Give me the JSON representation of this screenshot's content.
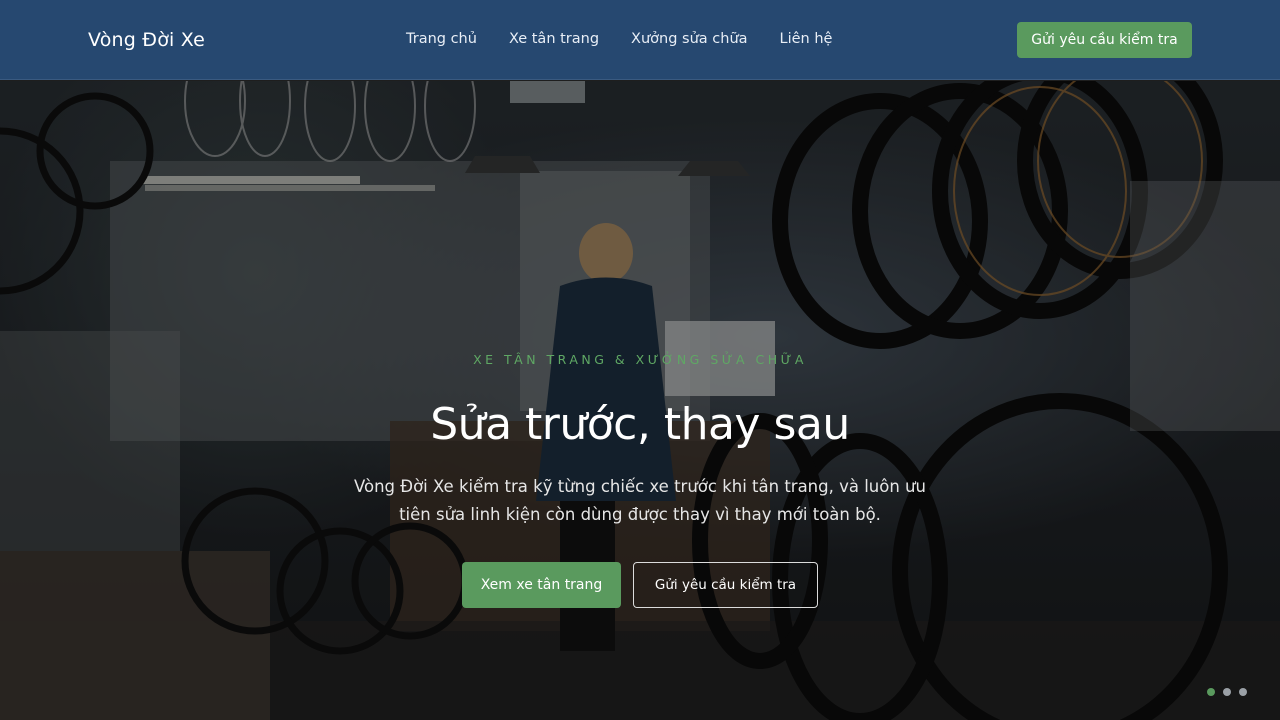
{
  "header": {
    "brand": "Vòng Đời Xe",
    "nav": [
      "Trang chủ",
      "Xe tân trang",
      "Xưởng sửa chữa",
      "Liên hệ"
    ],
    "cta": "Gửi yêu cầu kiểm tra"
  },
  "hero": {
    "eyebrow": "XE TÂN TRANG & XƯỞNG SỬA CHỮA",
    "title": "Sửa trước, thay sau",
    "description": "Vòng Đời Xe kiểm tra kỹ từng chiếc xe trước khi tân trang, và luôn ưu tiên sửa linh kiện còn dùng được thay vì thay mới toàn bộ.",
    "primary_button": "Xem xe tân trang",
    "secondary_button": "Gửi yêu cầu kiểm tra",
    "slides": 3,
    "active_slide": 1
  },
  "colors": {
    "header_bg": "#264870",
    "accent_green": "#5a9a5e"
  }
}
